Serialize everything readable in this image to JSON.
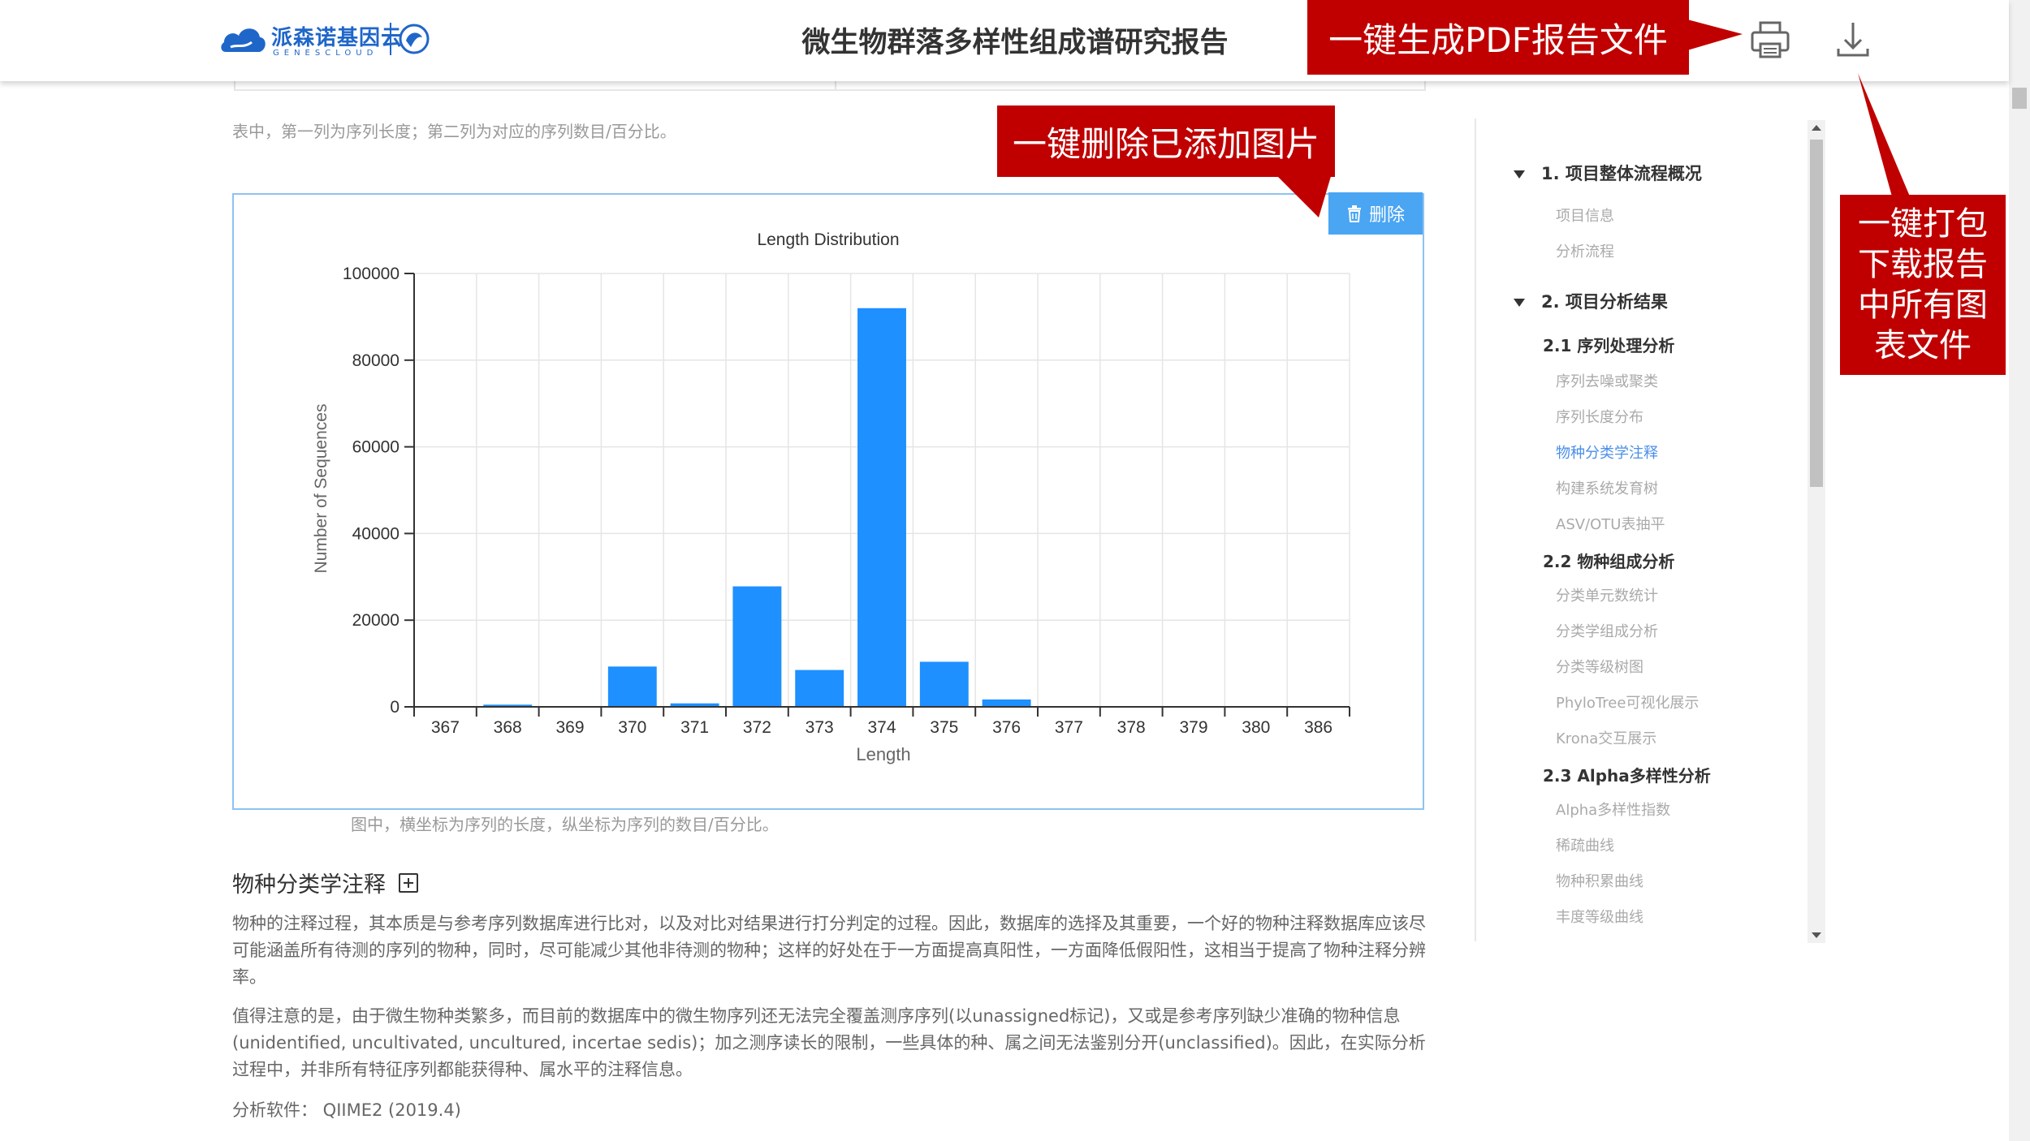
{
  "header": {
    "logo_text": "派森诺基因云",
    "logo_sub": "GENESCLOUD",
    "title": "微生物群落多样性组成谱研究报告",
    "print_icon": "printer-icon",
    "download_icon": "download-icon"
  },
  "content": {
    "table_note": "表中，第一列为序列长度；第二列为对应的序列数目/百分比。",
    "delete_button_label": "删除",
    "delete_icon": "trash-icon",
    "figure_note": "图中，横坐标为序列的长度，纵坐标为序列的数目/百分比。",
    "section_heading": "物种分类学注释",
    "expand_icon": "plus-square-icon",
    "para_1": "物种的注释过程，其本质是与参考序列数据库进行比对，以及对比对结果进行打分判定的过程。因此，数据库的选择及其重要，一个好的物种注释数据库应该尽可能涵盖所有待测的序列的物种，同时，尽可能减少其他非待测的物种；这样的好处在于一方面提高真阳性，一方面降低假阳性，这相当于提高了物种注释分辨率。",
    "para_2": "值得注意的是，由于微生物种类繁多，而目前的数据库中的微生物序列还无法完全覆盖测序序列(以unassigned标记)，又或是参考序列缺少准确的物种信息(unidentified, uncultivated, uncultured, incertae sedis)；加之测序读长的限制，一些具体的种、属之间无法鉴别分开(unclassified)。因此，在实际分析过程中，并非所有特征序列都能获得种、属水平的注释信息。",
    "software_line": "分析软件： QIIME2 (2019.4)"
  },
  "chart_data": {
    "type": "bar",
    "title": "Length Distribution",
    "xlabel": "Length",
    "ylabel": "Number of Sequences",
    "categories": [
      "367",
      "368",
      "369",
      "370",
      "371",
      "372",
      "373",
      "374",
      "375",
      "376",
      "377",
      "378",
      "379",
      "380",
      "386"
    ],
    "values": [
      0,
      500,
      0,
      9300,
      800,
      27800,
      8500,
      92000,
      10400,
      1700,
      0,
      0,
      0,
      0,
      0
    ],
    "ylim": [
      0,
      100000
    ],
    "yticks": [
      0,
      20000,
      40000,
      60000,
      80000,
      100000
    ],
    "grid": true,
    "bar_color": "#1e90ff"
  },
  "toc": {
    "section_1": "1. 项目整体流程概况",
    "s1_items": [
      "项目信息",
      "分析流程"
    ],
    "section_2": "2. 项目分析结果",
    "sub_2_1": "2.1 序列处理分析",
    "s21_items": [
      "序列去噪或聚类",
      "序列长度分布",
      "物种分类学注释",
      "构建系统发育树",
      "ASV/OTU表抽平"
    ],
    "active_item": "物种分类学注释",
    "sub_2_2": "2.2 物种组成分析",
    "s22_items": [
      "分类单元数统计",
      "分类学组成分析",
      "分类等级树图",
      "PhyloTree可视化展示",
      "Krona交互展示"
    ],
    "sub_2_3": "2.3 Alpha多样性分析",
    "s23_items": [
      "Alpha多样性指数",
      "稀疏曲线",
      "物种积累曲线",
      "丰度等级曲线"
    ]
  },
  "callouts": {
    "pdf": "一键生成PDF报告文件",
    "delete": "一键删除已添加图片",
    "download": "一键打包\n下载报告\n中所有图\n表文件"
  },
  "colors": {
    "callout": "#c00000",
    "delete_button": "#4aa5f3",
    "figure_border": "#8ec2f2",
    "toc_active": "#4a8fe8",
    "logo": "#1f66c9"
  }
}
